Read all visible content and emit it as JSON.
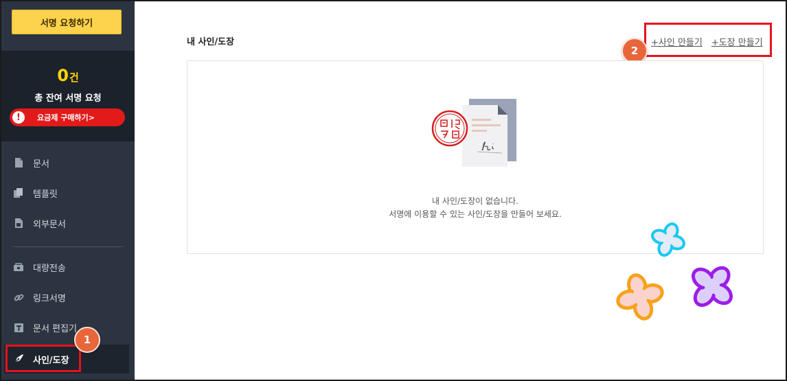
{
  "sidebar": {
    "request_button": "서명 요청하기",
    "quota": {
      "count": "0",
      "unit": "건",
      "label": "총 잔여 서명 요청",
      "buy_label": "요금제 구매하기>"
    },
    "items": [
      {
        "label": "문서",
        "icon": "document-icon"
      },
      {
        "label": "템플릿",
        "icon": "template-icon"
      },
      {
        "label": "외부문서",
        "icon": "external-document-icon"
      },
      {
        "label": "대량전송",
        "icon": "bulk-send-icon"
      },
      {
        "label": "링크서명",
        "icon": "link-icon"
      },
      {
        "label": "문서 편집기",
        "icon": "text-editor-icon"
      },
      {
        "label": "사인/도장",
        "icon": "pen-nib-icon",
        "active": true
      }
    ]
  },
  "main": {
    "title": "내 사인/도장",
    "create_sign_link": "+사인 만들기",
    "create_stamp_link": "+도장 만들기",
    "empty_title": "내 사인/도장이 없습니다.",
    "empty_desc": "서명에 이용할 수 있는 사인/도장을 만들어 보세요."
  },
  "annotations": {
    "badge_1": "1",
    "badge_2": "2",
    "highlight_color": "#e8101e",
    "badge_color": "#e8663b"
  },
  "colors": {
    "sidebar_bg": "#2b3440",
    "accent_yellow": "#fdd34d",
    "alert_red": "#e21a1a"
  }
}
